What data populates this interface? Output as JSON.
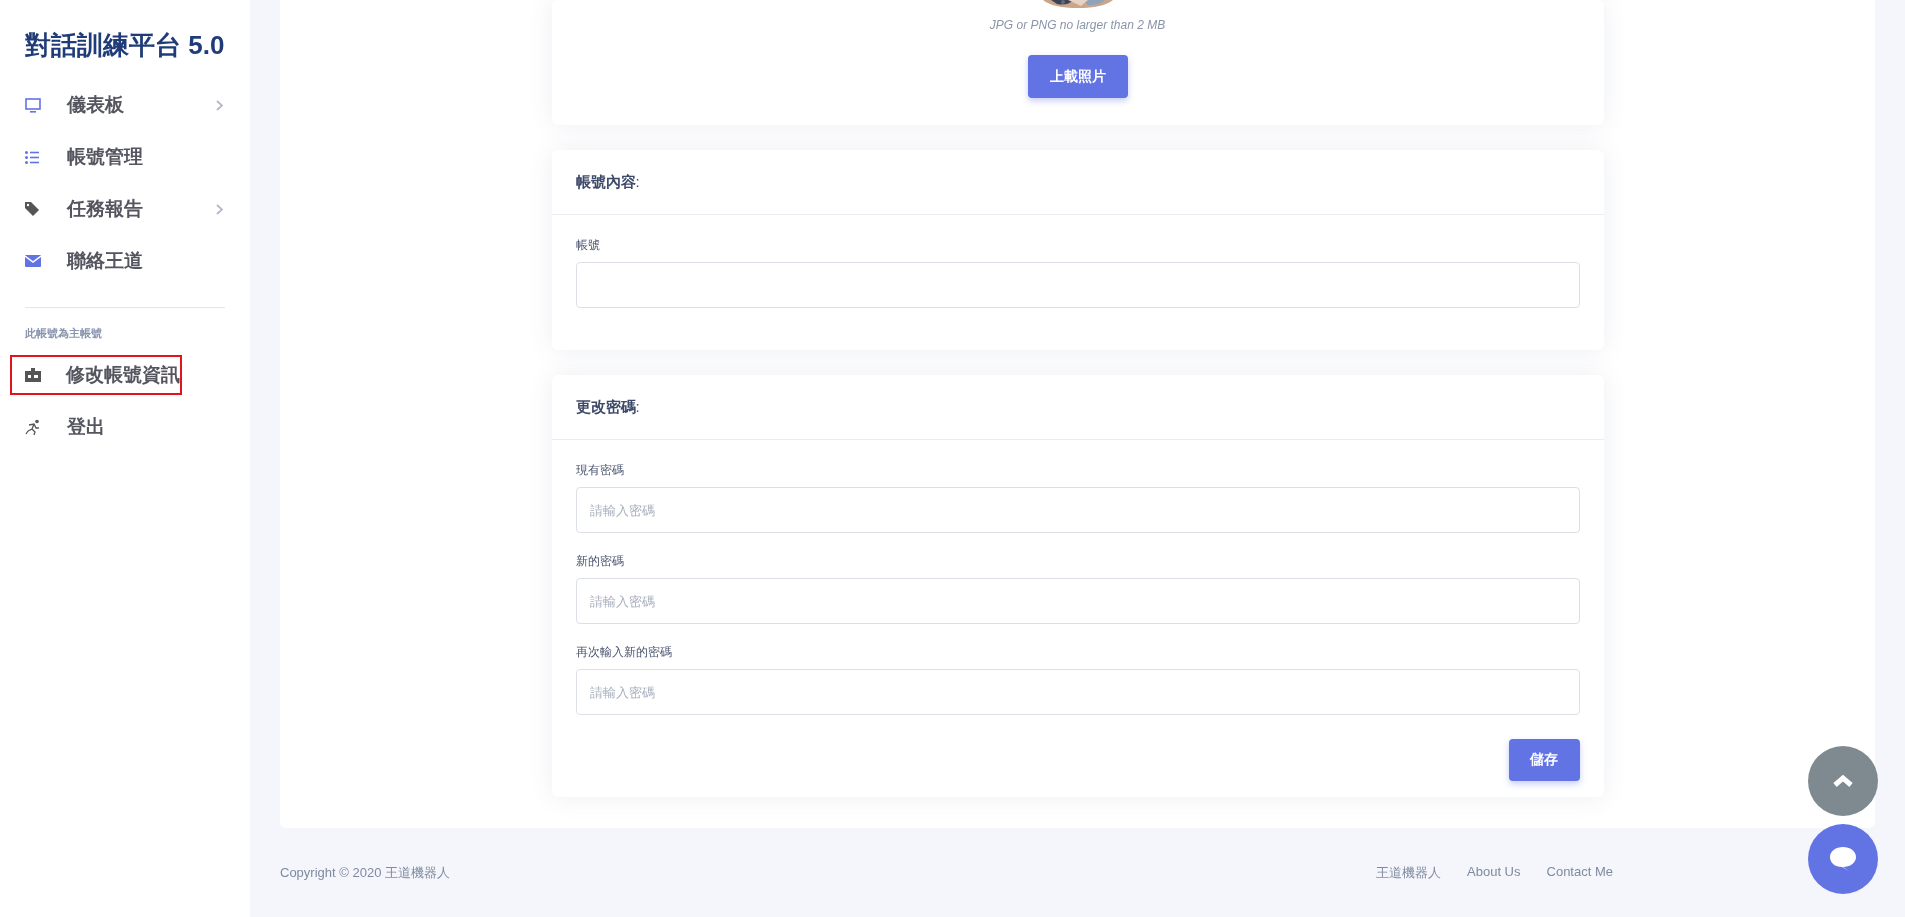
{
  "sidebar": {
    "title": "對話訓練平台 5.0",
    "items": [
      {
        "label": "儀表板",
        "has_submenu": true,
        "highlighted": false
      },
      {
        "label": "帳號管理",
        "has_submenu": false,
        "highlighted": false
      },
      {
        "label": "任務報告",
        "has_submenu": true,
        "highlighted": false
      },
      {
        "label": "聯絡王道",
        "has_submenu": false,
        "highlighted": false
      }
    ],
    "section_label": "此帳號為主帳號",
    "account_items": [
      {
        "label": "修改帳號資訊",
        "highlighted": true
      },
      {
        "label": "登出",
        "highlighted": false
      }
    ]
  },
  "photo_card": {
    "hint": "JPG or PNG no larger than 2 MB",
    "button": "上載照片"
  },
  "account_card": {
    "title": "帳號內容",
    "title_suffix": ":",
    "field": {
      "label": "帳號"
    }
  },
  "password_card": {
    "title": "更改密碼",
    "title_suffix": ":",
    "fields": [
      {
        "label": "現有密碼",
        "placeholder": "請輸入密碼"
      },
      {
        "label": "新的密碼",
        "placeholder": "請輸入密碼"
      },
      {
        "label": "再次輸入新的密碼",
        "placeholder": "請輸入密碼"
      }
    ],
    "button": "儲存"
  },
  "footer": {
    "copyright": "Copyright © 2020 王道機器人",
    "links": [
      "王道機器人",
      "About Us",
      "Contact Me"
    ]
  }
}
